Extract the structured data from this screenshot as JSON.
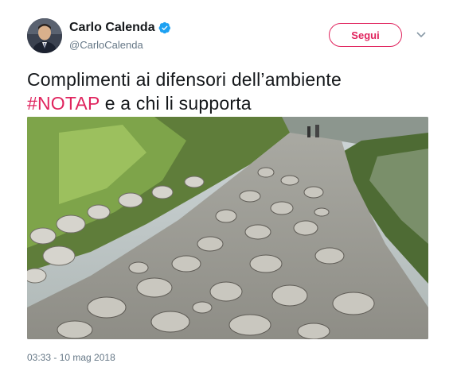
{
  "author": {
    "name": "Carlo Calenda",
    "handle": "@CarloCalenda",
    "verified": true
  },
  "actions": {
    "follow_label": "Segui"
  },
  "tweet": {
    "text_line1": "Complimenti ai difensori dell’ambiente",
    "hashtag": "#NOTAP",
    "text_line2_rest": " e a chi li supporta"
  },
  "meta": {
    "timestamp": "03:33 - 10 mag 2018"
  },
  "colors": {
    "accent": "#e0245e",
    "verified": "#1da1f2",
    "muted": "#657786"
  },
  "icons": {
    "verified": "verified-badge-icon",
    "caret": "chevron-down-icon"
  },
  "media": {
    "type": "video-frame",
    "description_icon": "video-thumbnail"
  }
}
